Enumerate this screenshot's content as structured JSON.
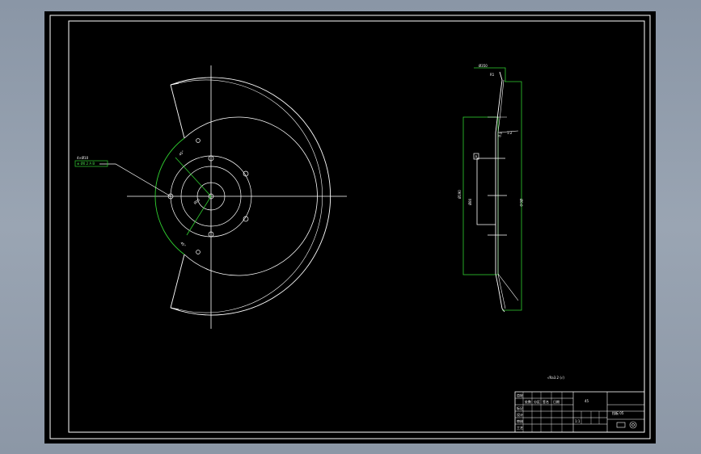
{
  "drawing": {
    "background_color": "#000000",
    "line_color": "#ffffff",
    "dimension_color": "#30d030",
    "view_names": [
      "front-view",
      "section-view"
    ],
    "front_view": {
      "leader_note_top": "4×Ø10",
      "leader_note_bottom": "⊕ Ø0.2 A B",
      "small_labels": [
        "45°",
        "45°",
        "R3",
        "Ø20"
      ]
    },
    "section_view": {
      "top_note": "Ø350",
      "tolerance_labels": [
        "R1",
        "0.5",
        "1:2"
      ],
      "datum_label": "A",
      "diameter_labels": [
        "Ø190",
        "Ø80",
        "Ø0.0"
      ]
    },
    "roughness_note": "√Ra3.2 (√)",
    "title_block": {
      "material_code": "45",
      "drawing_name": "挡板 05",
      "part_name": "齿轮",
      "scale": "1:1",
      "row_labels": [
        "标记",
        "设计",
        "审核",
        "工艺"
      ],
      "column_labels": [
        "处数",
        "分区",
        "签名",
        "日期"
      ]
    }
  }
}
